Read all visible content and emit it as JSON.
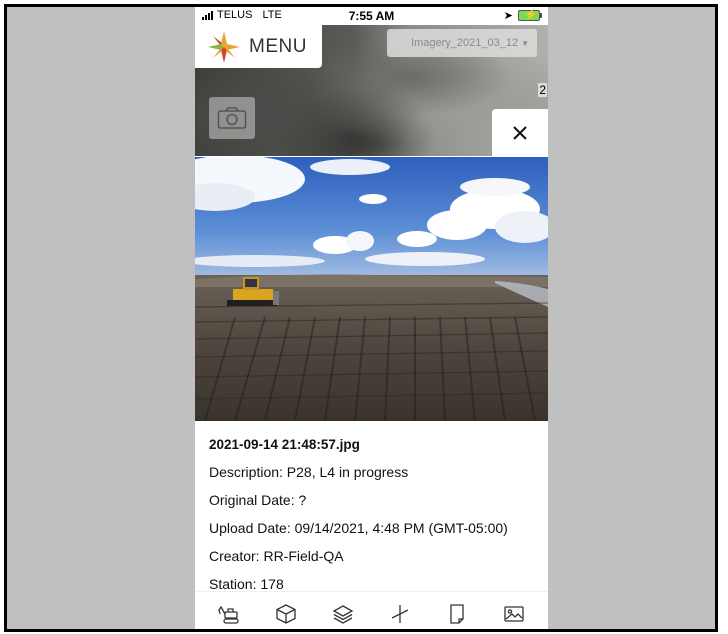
{
  "status_bar": {
    "carrier": "TELUS",
    "network": "LTE",
    "time": "7:55 AM"
  },
  "map": {
    "menu_label": "MENU",
    "imagery_select": "Imagery_2021_03_12",
    "map_number": "2"
  },
  "photo_info": {
    "filename": "2021-09-14 21:48:57.jpg",
    "description": "Description: P28, L4 in progress",
    "original_date": "Original Date: ?",
    "upload_date": "Upload Date: 09/14/2021, 4:48 PM (GMT-05:00)",
    "creator": "Creator: RR-Field-QA",
    "station": "Station: 178"
  },
  "toolbar": {
    "icons": [
      "excavator-icon",
      "cube-icon",
      "layers-icon",
      "measure-icon",
      "document-icon",
      "image-icon"
    ]
  },
  "colors": {
    "frame_bg": "#c0c0c0",
    "sky": "#3d6ec9",
    "ground": "#5b5147"
  }
}
